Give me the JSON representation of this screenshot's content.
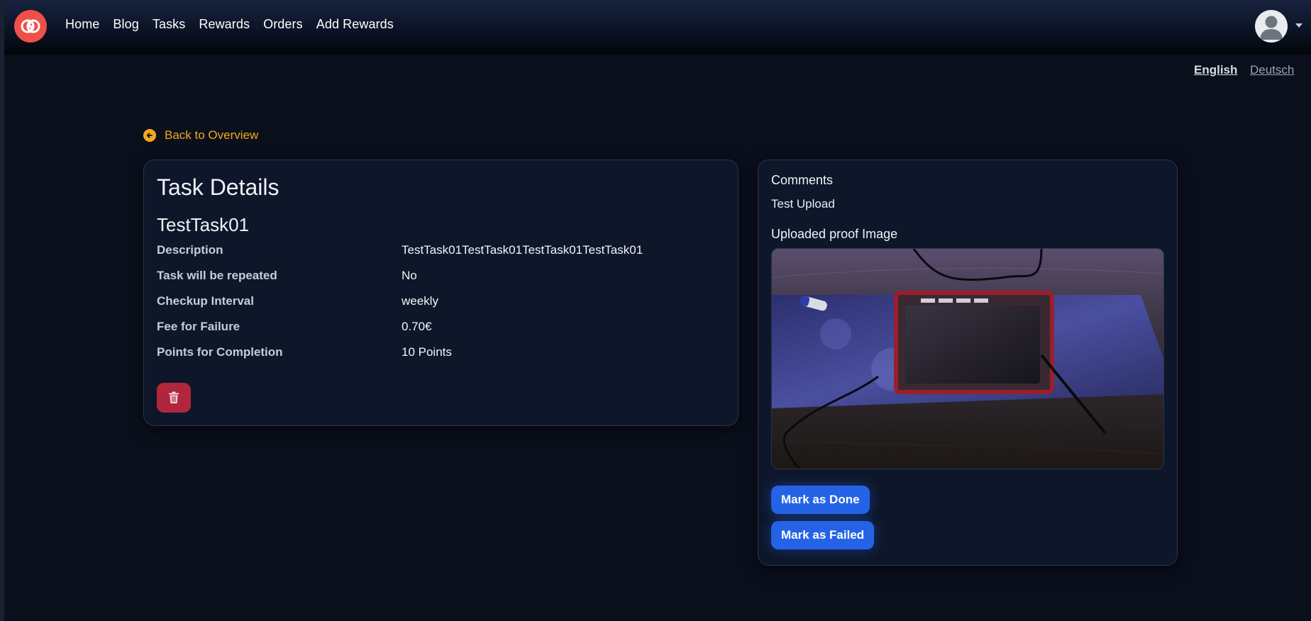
{
  "nav": {
    "items": [
      {
        "label": "Home"
      },
      {
        "label": "Blog"
      },
      {
        "label": "Tasks"
      },
      {
        "label": "Rewards"
      },
      {
        "label": "Orders"
      },
      {
        "label": "Add Rewards"
      }
    ]
  },
  "language": {
    "english": "English",
    "deutsch": "Deutsch",
    "active": "English"
  },
  "back_link": "Back to Overview",
  "task": {
    "heading": "Task Details",
    "name": "TestTask01",
    "details": [
      {
        "label": "Description",
        "value": "TestTask01TestTask01TestTask01TestTask01"
      },
      {
        "label": "Task will be repeated",
        "value": "No"
      },
      {
        "label": "Checkup Interval",
        "value": "weekly"
      },
      {
        "label": "Fee for Failure",
        "value": "0.70€"
      },
      {
        "label": "Points for Completion",
        "value": "10 Points"
      }
    ],
    "delete_icon": "trash-icon"
  },
  "review": {
    "comments_heading": "Comments",
    "comment": "Test Upload",
    "image_heading": "Uploaded proof Image",
    "mark_done": "Mark as Done",
    "mark_failed": "Mark as Failed"
  },
  "colors": {
    "accent": "#f2a81d",
    "primary": "#2563e6",
    "danger": "#b1263d",
    "logo": "#f0504a",
    "background": "#0a0f1c",
    "card": "#0e1629"
  }
}
